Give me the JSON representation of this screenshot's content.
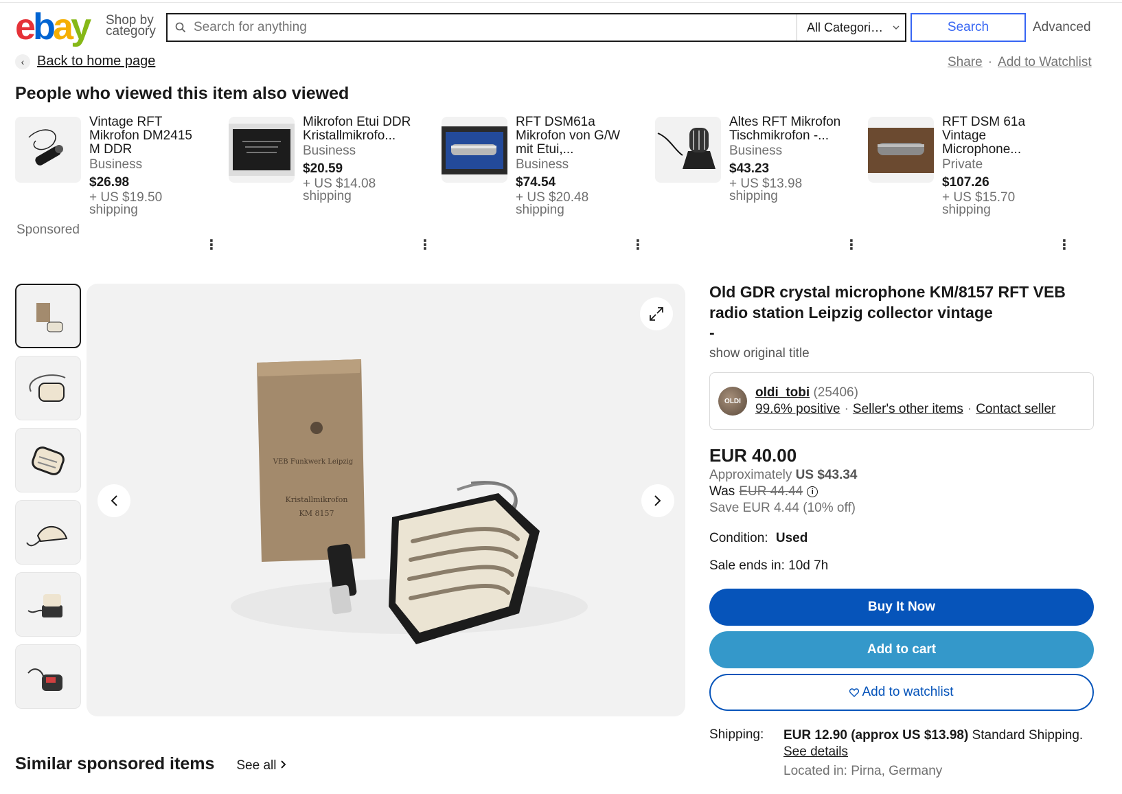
{
  "header": {
    "logo_letters": [
      "e",
      "b",
      "a",
      "y"
    ],
    "shop_by": "Shop by category",
    "search_placeholder": "Search for anything",
    "category": "All Categori…",
    "search_label": "Search",
    "advanced_label": "Advanced"
  },
  "nav": {
    "back_label": "Back to home page",
    "share_label": "Share",
    "sep": "·",
    "watchlist_label": "Add to Watchlist"
  },
  "also_viewed": {
    "title": "People who viewed this item also viewed",
    "sponsored": "Sponsored",
    "items": [
      {
        "title": "Vintage RFT Mikrofon DM2415 M DDR",
        "seller": "Business",
        "price": "$26.98",
        "shipping": "+ US $19.50 shipping"
      },
      {
        "title": "Mikrofon Etui DDR Kristallmikrofo...",
        "seller": "Business",
        "price": "$20.59",
        "shipping": "+ US $14.08 shipping"
      },
      {
        "title": "RFT DSM61a Mikrofon von G/W mit Etui,...",
        "seller": "Business",
        "price": "$74.54",
        "shipping": "+ US $20.48 shipping"
      },
      {
        "title": "Altes RFT Mikrofon Tischmikrofon -...",
        "seller": "Business",
        "price": "$43.23",
        "shipping": "+ US $13.98 shipping"
      },
      {
        "title": "RFT DSM 61a Vintage Microphone...",
        "seller": "Private",
        "price": "$107.26",
        "shipping": "+ US $15.70 shipping"
      }
    ]
  },
  "box_label": {
    "line1": "VEB Funkwerk Leipzig",
    "line2": "Kristallmikrofon",
    "line3": "KM 8157"
  },
  "item": {
    "title": "Old GDR crystal microphone KM/8157 RFT VEB radio station Leipzig collector vintage",
    "dash": "-",
    "show_original": "show original title",
    "seller_name": "oldi_tobi",
    "seller_count": "(25406)",
    "positive": "99.6% positive",
    "other_items": "Seller's other items",
    "contact": "Contact seller",
    "price": "EUR 40.00",
    "approx_label": "Approximately",
    "approx_value": "US $43.34",
    "was_label": "Was",
    "was_value": "EUR 44.44",
    "save": "Save EUR 4.44 (10% off)",
    "condition_label": "Condition:",
    "condition_value": "Used",
    "sale_ends": "Sale ends in:  10d 7h",
    "buy_now": "Buy It Now",
    "add_cart": "Add to cart",
    "add_watchlist": "Add to watchlist",
    "shipping_label": "Shipping:",
    "shipping_value": "EUR 12.90 (approx US $13.98)",
    "shipping_type": "Standard Shipping.",
    "see_details": "See details",
    "located": "Located in: Pirna, Germany"
  },
  "similar": {
    "title": "Similar sponsored items",
    "see_all": "See all"
  },
  "colors": {
    "primary_blue": "#0654ba",
    "secondary_blue": "#3498ca",
    "search_blue": "#3665f3"
  }
}
